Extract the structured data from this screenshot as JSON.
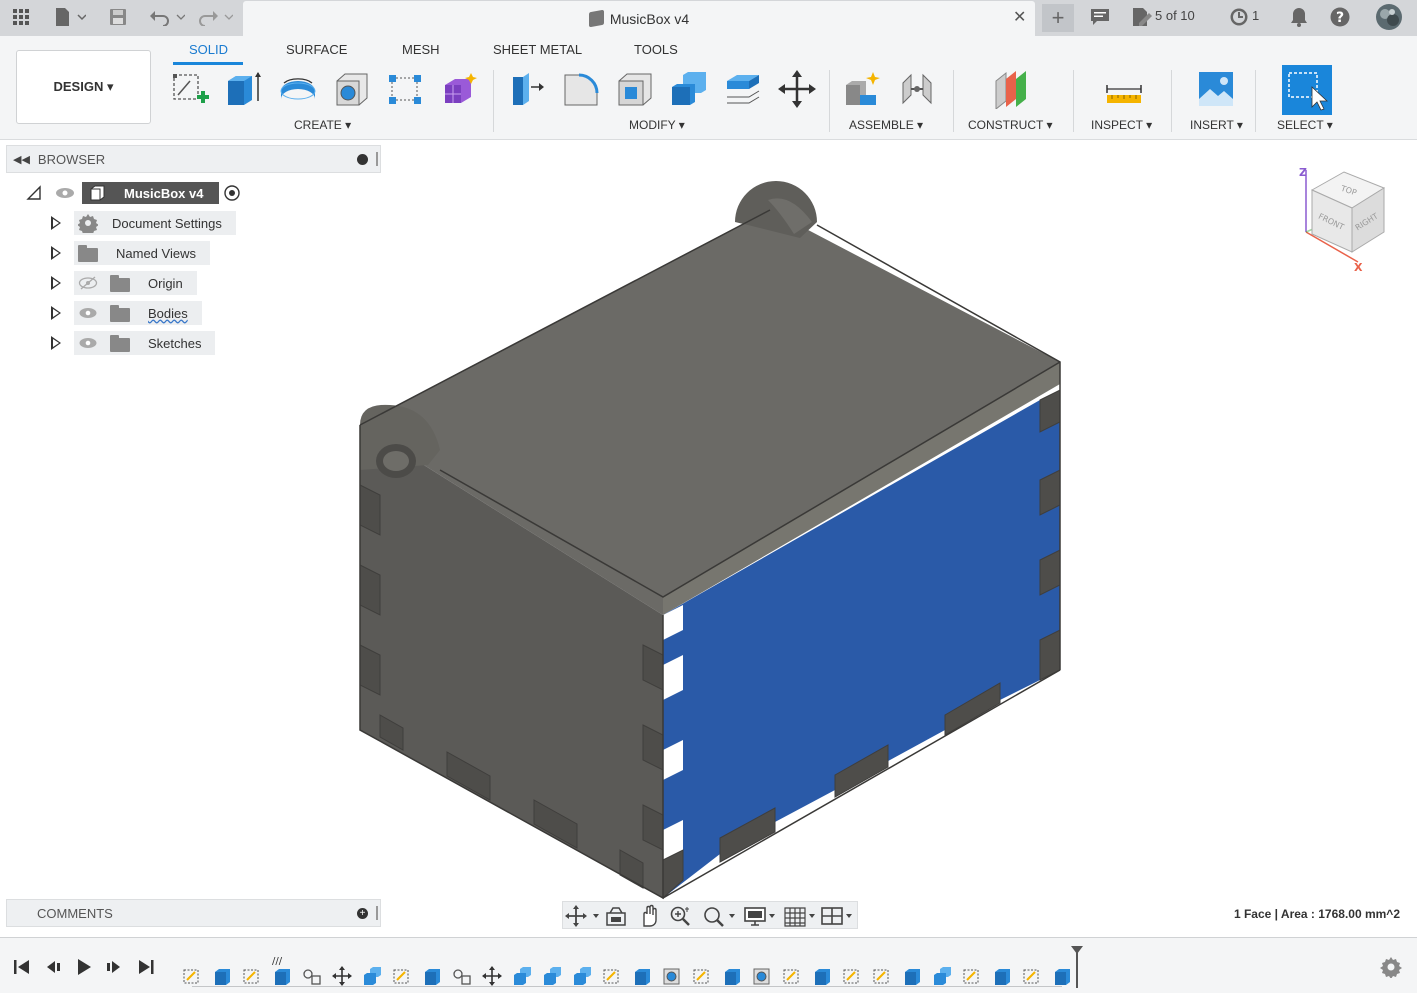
{
  "titlebar": {
    "document_title": "MusicBox v4",
    "job_status": "5 of 10",
    "notifications_count": "1"
  },
  "ribbon": {
    "workspace": "DESIGN ▾",
    "tabs": [
      "SOLID",
      "SURFACE",
      "MESH",
      "SHEET METAL",
      "TOOLS"
    ],
    "groups": {
      "create": "CREATE ▾",
      "modify": "MODIFY ▾",
      "assemble": "ASSEMBLE ▾",
      "construct": "CONSTRUCT ▾",
      "inspect": "INSPECT ▾",
      "insert": "INSERT ▾",
      "select": "SELECT ▾"
    }
  },
  "browser": {
    "header": "BROWSER",
    "root": "MusicBox v4",
    "items": [
      "Document Settings",
      "Named Views",
      "Origin",
      "Bodies",
      "Sketches"
    ]
  },
  "comments": {
    "header": "COMMENTS"
  },
  "viewcube": {
    "top": "TOP",
    "front": "FRONT",
    "right": "RIGHT",
    "z": "Z",
    "x": "X"
  },
  "status": {
    "selection": "1 Face | Area : 1768.00 mm^2"
  },
  "colors": {
    "accent": "#1a86da",
    "selected_face": "#2a5aa8",
    "body": "#5a5957",
    "body_top": "#6b6a66"
  }
}
